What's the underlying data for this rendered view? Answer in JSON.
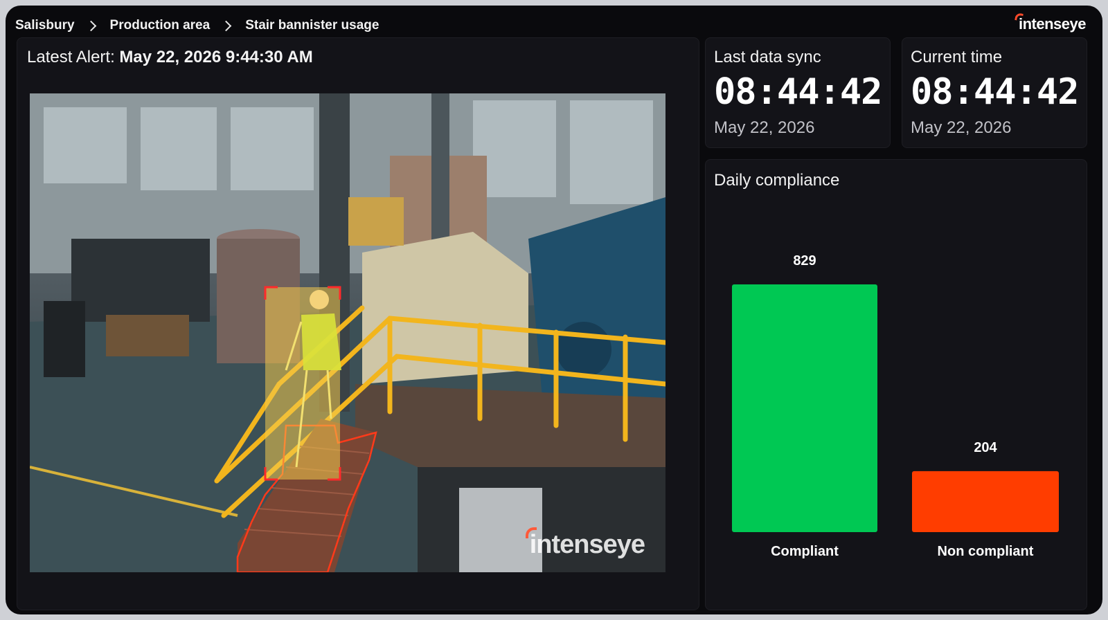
{
  "breadcrumb": {
    "items": [
      "Salisbury",
      "Production area",
      "Stair bannister usage"
    ]
  },
  "brand": {
    "name": "intenseye"
  },
  "alert": {
    "label": "Latest Alert:",
    "value": "May 22, 2026 9:44:30 AM"
  },
  "camera": {
    "watermark": "intenseye",
    "status_colors": {
      "detection_box": "#ff2a2a",
      "person_highlight": "#f2c94c",
      "stair_outline": "#ff3a1a"
    }
  },
  "sync": {
    "label": "Last data sync",
    "time": "08:44:42",
    "date": "May 22, 2026"
  },
  "current": {
    "label": "Current time",
    "time": "08:44:42",
    "date": "May 22, 2026"
  },
  "chart": {
    "title": "Daily compliance"
  },
  "chart_data": {
    "type": "bar",
    "title": "Daily compliance",
    "categories": [
      "Compliant",
      "Non compliant"
    ],
    "values": [
      829,
      204
    ],
    "colors": [
      "#00c853",
      "#ff3d00"
    ],
    "xlabel": "",
    "ylabel": "",
    "ylim": [
      0,
      829
    ],
    "grid": false,
    "data_labels": true
  }
}
